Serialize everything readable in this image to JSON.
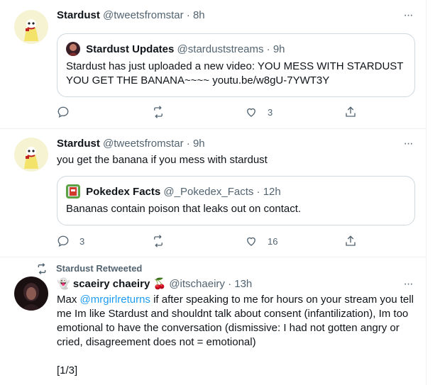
{
  "tweets": [
    {
      "name": "Stardust",
      "handle": "@tweetsfromstar",
      "dot": "·",
      "time": "8h",
      "more": "···",
      "quote": {
        "name": "Stardust Updates",
        "handle": "@starduststreams",
        "dot": "·",
        "time": "9h",
        "text": "Stardust has just uploaded a new video: YOU MESS WITH STARDUST YOU GET THE BANANA~~~~ youtu.be/w8gU-7YWT3Y"
      },
      "actions": {
        "replies": "",
        "retweets": "",
        "likes": "3"
      }
    },
    {
      "name": "Stardust",
      "handle": "@tweetsfromstar",
      "dot": "·",
      "time": "9h",
      "more": "···",
      "text": "you get the banana if you mess with stardust",
      "quote": {
        "name": "Pokedex Facts",
        "handle": "@_Pokedex_Facts",
        "dot": "·",
        "time": "12h",
        "text": "Bananas contain poison that leaks out on contact."
      },
      "actions": {
        "replies": "3",
        "retweets": "",
        "likes": "16"
      }
    },
    {
      "retweeted_by": "Stardust Retweeted",
      "name_prefix": "👻",
      "name": "scaeiry chaeiry",
      "name_suffix": "🍒",
      "handle": "@itschaeiry",
      "dot": "·",
      "time": "13h",
      "more": "···",
      "text_start": "Max ",
      "mention": "@mrgirlreturns",
      "text_rest": " if after speaking to me for hours on your stream you tell me Im like Stardust and shouldnt talk about consent (infantilization), Im too emotional to have the conversation (dismissive: I had not gotten angry or cried, disagreement does not = emotional)",
      "thread_marker": "[1/3]"
    }
  ],
  "colors": {
    "text": "#0f1419",
    "secondary": "#536471",
    "link": "#1d9bf0",
    "border": "#cfd9de",
    "divider": "#eff3f4"
  },
  "icons": [
    "reply-icon",
    "retweet-icon",
    "like-icon",
    "share-icon",
    "more-icon"
  ]
}
